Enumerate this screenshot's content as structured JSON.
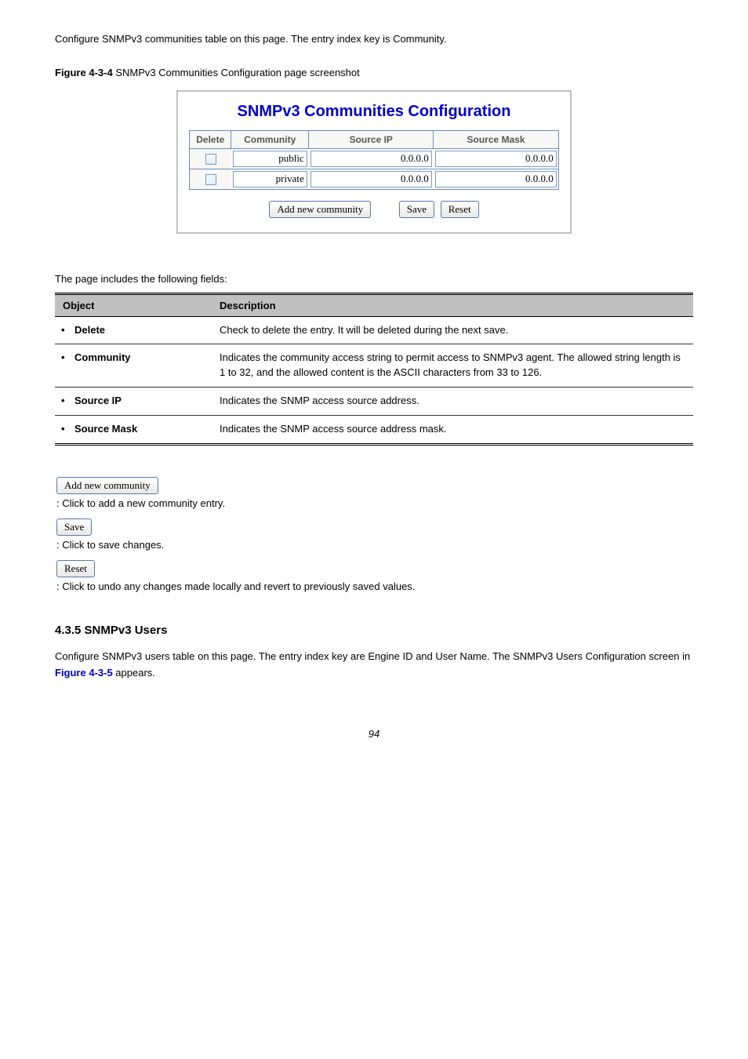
{
  "intro": "Configure SNMPv3 communities table on this page. The entry index key is Community.",
  "figure": {
    "label": "Figure 4-3-4",
    "caption": "SNMPv3 Communities Configuration page screenshot"
  },
  "panel": {
    "title": "SNMPv3 Communities Configuration",
    "headers": {
      "delete": "Delete",
      "community": "Community",
      "source_ip": "Source IP",
      "source_mask": "Source Mask"
    },
    "rows": [
      {
        "community": "public",
        "source_ip": "0.0.0.0",
        "source_mask": "0.0.0.0"
      },
      {
        "community": "private",
        "source_ip": "0.0.0.0",
        "source_mask": "0.0.0.0"
      }
    ],
    "buttons": {
      "add": "Add new community",
      "save": "Save",
      "reset": "Reset"
    }
  },
  "desc_intro": "The page includes the following fields:",
  "desc_table": {
    "headers": {
      "object": "Object",
      "description": "Description"
    },
    "rows": [
      {
        "object": "Delete",
        "description": "Check to delete the entry. It will be deleted during the next save."
      },
      {
        "object": "Community",
        "description": "Indicates the community access string to permit access to SNMPv3 agent. The allowed string length is 1 to 32, and the allowed content is the ASCII characters from 33 to 126."
      },
      {
        "object": "Source IP",
        "description": "Indicates the SNMP access source address."
      },
      {
        "object": "Source Mask",
        "description": "Indicates the SNMP access source address mask."
      }
    ]
  },
  "button_descs": [
    {
      "label": "Add new community",
      "text": ": Click to add a new community entry."
    },
    {
      "label": "Save",
      "text": ": Click to save changes."
    },
    {
      "label": "Reset",
      "text": ": Click to undo any changes made locally and revert to previously saved values."
    }
  ],
  "section": {
    "heading": "4.3.5 SNMPv3 Users",
    "body_pre": "Configure SNMPv3 users table on this page. The entry index key are Engine ID and User Name. The SNMPv3 Users Configuration screen in ",
    "ref": "Figure 4-3-5",
    "body_post": " appears."
  },
  "footer": "94"
}
